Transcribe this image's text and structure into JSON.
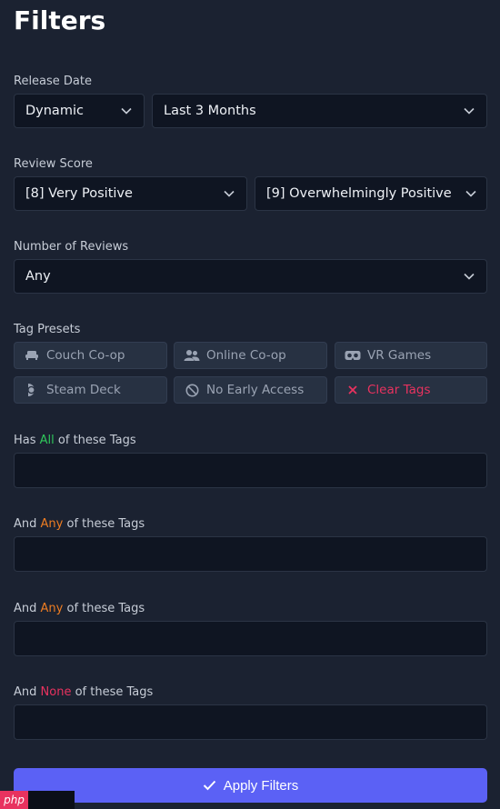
{
  "page": {
    "title": "Filters"
  },
  "release_date": {
    "label": "Release Date",
    "mode_value": "Dynamic",
    "range_value": "Last 3 Months"
  },
  "review_score": {
    "label": "Review Score",
    "min_value": "[8] Very Positive",
    "max_value": "[9] Overwhelmingly Positive"
  },
  "num_reviews": {
    "label": "Number of Reviews",
    "value": "Any"
  },
  "tag_presets": {
    "label": "Tag Presets",
    "items": [
      {
        "label": "Couch Co-op",
        "icon": "sofa-icon"
      },
      {
        "label": "Online Co-op",
        "icon": "users-icon"
      },
      {
        "label": "VR Games",
        "icon": "vr-headset-icon"
      },
      {
        "label": "Steam Deck",
        "icon": "steam-deck-icon"
      },
      {
        "label": "No Early Access",
        "icon": "no-entry-icon"
      },
      {
        "label": "Clear Tags",
        "icon": "x-icon"
      }
    ]
  },
  "tag_filters": {
    "all": {
      "prefix": "Has ",
      "keyword": "All",
      "suffix": " of these Tags",
      "value": ""
    },
    "any_1": {
      "prefix": "And ",
      "keyword": "Any",
      "suffix": " of these Tags",
      "value": ""
    },
    "any_2": {
      "prefix": "And ",
      "keyword": "Any",
      "suffix": " of these Tags",
      "value": ""
    },
    "none": {
      "prefix": "And ",
      "keyword": "None",
      "suffix": " of these Tags",
      "value": ""
    }
  },
  "apply_button": {
    "label": "Apply Filters",
    "icon": "check-icon"
  },
  "watermark": {
    "text": "php"
  },
  "colors": {
    "background": "#1b2231",
    "field_bg": "#0f1522",
    "chip_bg": "#273142",
    "accent": "#5b61f5",
    "all_keyword": "#2fc75a",
    "any_keyword": "#ee7d22",
    "none_keyword": "#e8325f"
  }
}
